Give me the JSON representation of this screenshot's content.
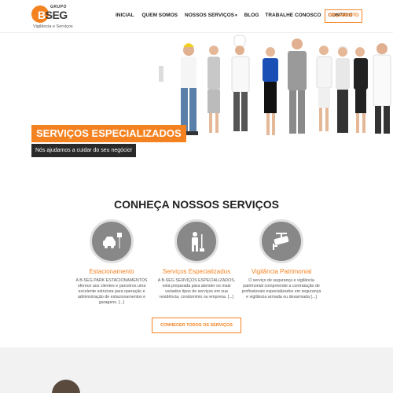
{
  "brand": {
    "grupo": "GRUPO",
    "name_prefix": "B",
    "name_suffix": "SEG",
    "tagline": "Vigilância e Serviços",
    "accent_color": "#f58220"
  },
  "nav": {
    "items": [
      {
        "label": "INICIAL"
      },
      {
        "label": "QUEM SOMOS"
      },
      {
        "label": "NOSSOS SERVIÇOS",
        "has_dropdown": true
      },
      {
        "label": "BLOG"
      },
      {
        "label": "TRABALHE CONOSCO"
      },
      {
        "label": "CONTATO"
      }
    ],
    "cta_label": "ORÇAMENTO"
  },
  "hero": {
    "title": "SERVIÇOS ESPECIALIZADOS",
    "subtitle": "Nós ajudamos a cuidar do seu negócio!"
  },
  "services": {
    "heading": "CONHEÇA NOSSOS SERVIÇOS",
    "items": [
      {
        "icon": "car-parking-icon",
        "name": "Estacionamento",
        "desc": "A B-SEG PARK ESTACIONAMENTOS oferece aos clientes e parceiros uma excelente estrutura para operação e administração de estacionamentos e garagens. [...]"
      },
      {
        "icon": "worker-icon",
        "name": "Serviços Especializados",
        "desc": "A B-SEG SERVIÇOS ESPECIALIZADOS, está preparada para atender os mais variados tipos de serviços em sua residência, condomínio ou empresa. [...]"
      },
      {
        "icon": "security-camera-icon",
        "name": "Vigilância Patrimonial",
        "desc": "O serviço de segurança e vigilância patrimonial compreende a contratação de profissionais especializados em segurança e vigilância armada ou desarmada [...]"
      }
    ],
    "button_label": "CONHECER TODOS OS SERVIÇOS"
  }
}
